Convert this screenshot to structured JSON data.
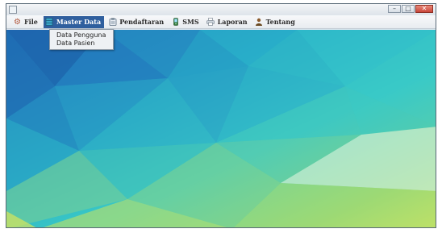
{
  "window": {
    "controls": {
      "minimize_icon": "minimize-icon",
      "maximize_icon": "maximize-icon",
      "close_icon": "close-icon"
    }
  },
  "menubar": {
    "items": [
      {
        "label": "File",
        "icon": "gear-icon"
      },
      {
        "label": "Master Data",
        "icon": "database-icon",
        "active": true
      },
      {
        "label": "Pendaftaran",
        "icon": "clipboard-icon"
      },
      {
        "label": "SMS",
        "icon": "phone-icon"
      },
      {
        "label": "Laporan",
        "icon": "printer-icon"
      },
      {
        "label": "Tentang",
        "icon": "person-icon"
      }
    ]
  },
  "dropdown": {
    "items": [
      {
        "label": "Data Pengguna"
      },
      {
        "label": "Data Pasien"
      }
    ]
  },
  "background": {
    "colors": {
      "deep_blue": "#1f6fb5",
      "teal": "#27b7c4",
      "cyan": "#3fd0cf",
      "green": "#98d66a",
      "yellow": "#e1e85a",
      "pale": "#c7ecd0"
    }
  },
  "colors": {
    "menu_active": "#2f5f9e"
  }
}
